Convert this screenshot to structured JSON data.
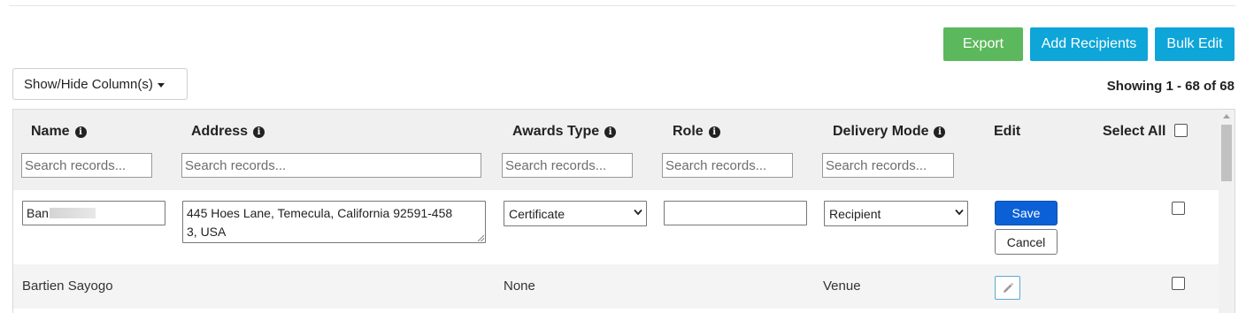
{
  "toolbar": {
    "export_label": "Export",
    "add_recipients_label": "Add Recipients",
    "bulk_edit_label": "Bulk Edit",
    "export_color": "#5cb85c",
    "primary_color": "#0ea5d9"
  },
  "controls": {
    "show_hide_label": "Show/Hide Column(s)",
    "showing_text": "Showing 1 - 68 of 68"
  },
  "table": {
    "columns": [
      {
        "label": "Name",
        "info_icon": "info-icon"
      },
      {
        "label": "Address",
        "info_icon": "info-icon"
      },
      {
        "label": "Awards Type",
        "info_icon": "info-icon"
      },
      {
        "label": "Role",
        "info_icon": "info-icon"
      },
      {
        "label": "Delivery Mode",
        "info_icon": "info-icon"
      },
      {
        "label": "Edit"
      },
      {
        "label": "Select All"
      }
    ],
    "search_placeholder": "Search records...",
    "edit_row": {
      "name_value": "Ban",
      "address_value": "445 Hoes Lane, Temecula, California 92591-4583, USA",
      "address_line1": "445 Hoes Lane, Temecula, California 92591-458",
      "address_line2": "3, USA",
      "awards_type": "Certificate",
      "role_value": "",
      "delivery_mode": "Recipient",
      "save_label": "Save",
      "cancel_label": "Cancel",
      "save_color": "#0b60d6"
    },
    "rows": [
      {
        "name": "Bartien Sayogo",
        "address": "",
        "awards_type": "None",
        "role": "",
        "delivery_mode": "Venue",
        "edit_icon": "pencil-icon"
      }
    ]
  }
}
